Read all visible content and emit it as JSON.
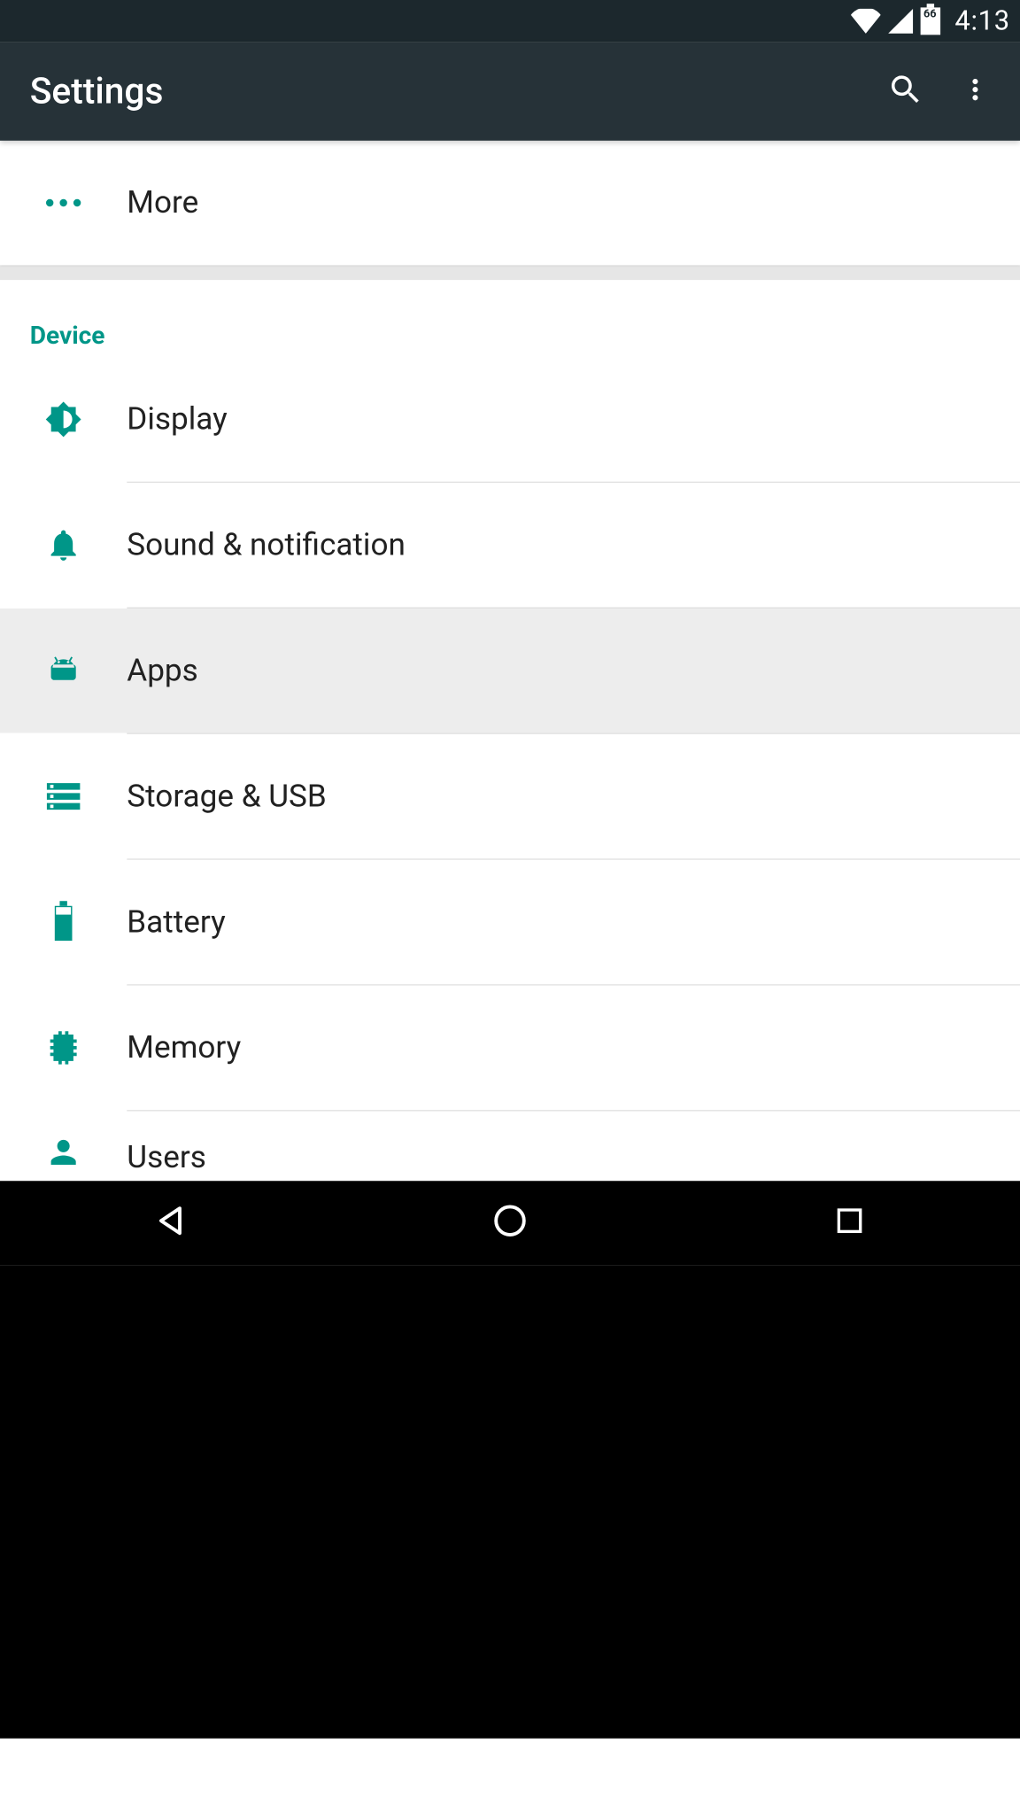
{
  "status": {
    "time": "4:13",
    "battery_percent": "66"
  },
  "appbar": {
    "title": "Settings"
  },
  "top_item": {
    "label": "More"
  },
  "section": {
    "header": "Device",
    "items": [
      {
        "id": "display",
        "label": "Display"
      },
      {
        "id": "sound",
        "label": "Sound & notification"
      },
      {
        "id": "apps",
        "label": "Apps"
      },
      {
        "id": "storage",
        "label": "Storage & USB"
      },
      {
        "id": "battery",
        "label": "Battery"
      },
      {
        "id": "memory",
        "label": "Memory"
      },
      {
        "id": "users",
        "label": "Users"
      }
    ]
  },
  "accent_color": "#009688"
}
